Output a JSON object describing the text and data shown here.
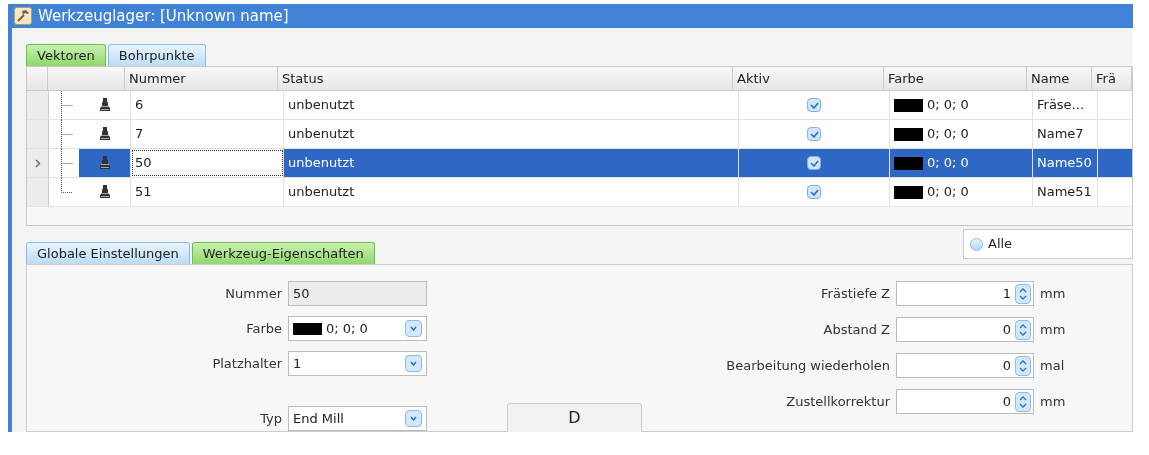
{
  "window": {
    "title": "Werkzeuglager: [Unknown name]"
  },
  "top_tabs": [
    {
      "label": "Vektoren",
      "selected": true
    },
    {
      "label": "Bohrpunkte",
      "selected": false
    }
  ],
  "table": {
    "columns": [
      "Nummer",
      "Status",
      "Aktiv",
      "Farbe",
      "Name",
      "Frä"
    ],
    "rows": [
      {
        "nummer": "6",
        "status": "unbenutzt",
        "aktiv": true,
        "farbe": {
          "color": "#000000",
          "text": "0; 0; 0"
        },
        "name": "Fräse...",
        "selected": false
      },
      {
        "nummer": "7",
        "status": "unbenutzt",
        "aktiv": true,
        "farbe": {
          "color": "#000000",
          "text": "0; 0; 0"
        },
        "name": "Name7",
        "selected": false
      },
      {
        "nummer": "50",
        "status": "unbenutzt",
        "aktiv": true,
        "farbe": {
          "color": "#000000",
          "text": "0; 0; 0"
        },
        "name": "Name50",
        "selected": true
      },
      {
        "nummer": "51",
        "status": "unbenutzt",
        "aktiv": true,
        "farbe": {
          "color": "#000000",
          "text": "0; 0; 0"
        },
        "name": "Name51",
        "selected": false
      }
    ]
  },
  "bottom_tabs": [
    {
      "label": "Globale Einstellungen",
      "selected": false
    },
    {
      "label": "Werkzeug-Eigenschaften",
      "selected": true
    }
  ],
  "filter": {
    "label": "Alle",
    "selected": false
  },
  "left_fields": [
    {
      "kind": "readonly",
      "label": "Nummer",
      "value": "50"
    },
    {
      "kind": "color",
      "label": "Farbe",
      "value": "0; 0; 0",
      "color": "#000000"
    },
    {
      "kind": "combo",
      "label": "Platzhalter",
      "value": "1"
    },
    {
      "kind": "combo",
      "label": "Typ",
      "value": "End Mill"
    }
  ],
  "right_fields": [
    {
      "label": "Frästiefe Z",
      "value": "1",
      "unit": "mm"
    },
    {
      "label": "Abstand Z",
      "value": "0",
      "unit": "mm"
    },
    {
      "label": "Bearbeitung wiederholen",
      "value": "0",
      "unit": "mal"
    },
    {
      "label": "Zustellkorrektur",
      "value": "0",
      "unit": "mm"
    }
  ],
  "diagram_button": {
    "label": "D"
  }
}
